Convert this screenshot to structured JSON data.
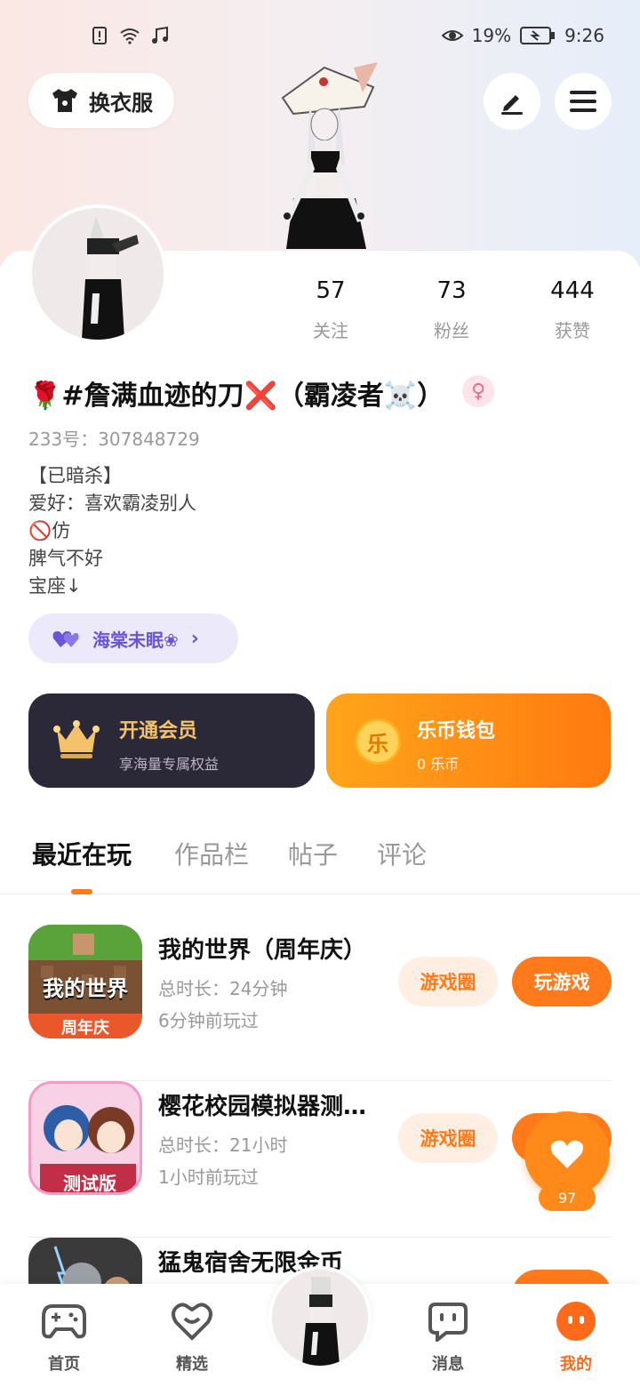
{
  "status_bar": {
    "battery": "19%",
    "time": "9:26"
  },
  "header": {
    "outfit_label": "换衣服"
  },
  "stats": [
    {
      "value": "57",
      "label": "关注"
    },
    {
      "value": "73",
      "label": "粉丝"
    },
    {
      "value": "444",
      "label": "获赞"
    }
  ],
  "profile": {
    "nickname": "🌹#詹满血迹的刀❌（霸凌者☠️）",
    "gender_symbol": "♀",
    "uid": "233号：307848729",
    "bio": [
      "【已暗杀】",
      "爱好：喜欢霸凌别人",
      "🚫仿",
      "脾气不好",
      "宝座↓"
    ],
    "club": "海棠未眠❀"
  },
  "vip": {
    "title": "开通会员",
    "subtitle": "享海量专属权益"
  },
  "wallet": {
    "icon_char": "乐",
    "title": "乐币钱包",
    "subtitle": "0 乐币"
  },
  "tabs": [
    "最近在玩",
    "作品栏",
    "帖子",
    "评论"
  ],
  "games": [
    {
      "name": "我的世界（周年庆）",
      "duration": "总时长：24分钟",
      "last_played": "6分钟前玩过",
      "icon_text": "我的世界",
      "icon_tag": "周年庆",
      "circle_label": "游戏圈",
      "play_label": "玩游戏"
    },
    {
      "name": "樱花校园模拟器测…",
      "duration": "总时长：21小时",
      "last_played": "1小时前玩过",
      "icon_tag": "测试版",
      "circle_label": "游戏圈",
      "play_label": "玩游戏"
    },
    {
      "name": "猛鬼宿舍无限金币"
    }
  ],
  "float_like": {
    "count": "97"
  },
  "bottom_nav": [
    "首页",
    "精选",
    "消息",
    "我的"
  ],
  "colors": {
    "accent": "#ff7a1a",
    "vip_bg": "#2b2838",
    "club": "#6a55d8"
  }
}
